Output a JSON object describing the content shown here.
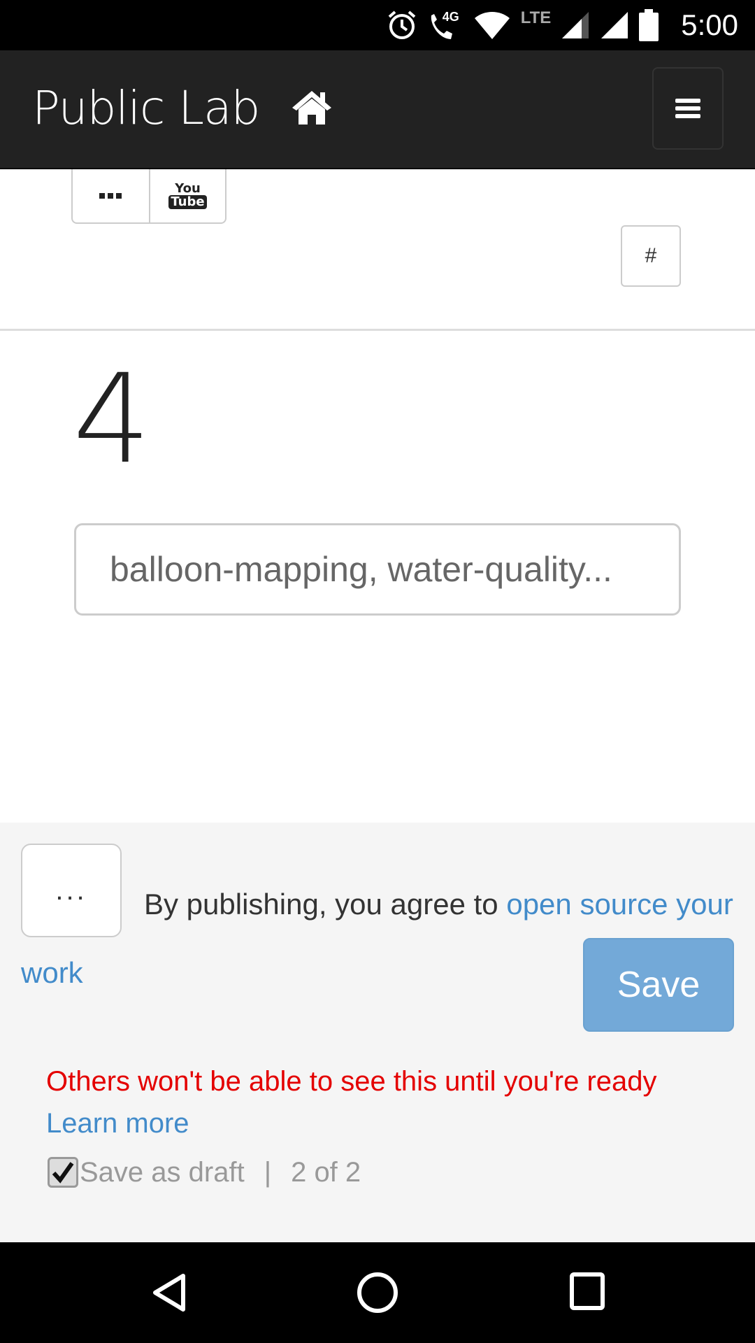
{
  "status_bar": {
    "network_label": "4G",
    "lte_label": "LTE",
    "time": "5:00",
    "icons": [
      "alarm-icon",
      "wifi-call-icon",
      "wifi-icon",
      "signal-icon",
      "signal-icon",
      "battery-icon"
    ]
  },
  "navbar": {
    "brand": "Public Lab",
    "home_icon": "home-icon",
    "menu_icon": "hamburger-menu-icon"
  },
  "toolbar": {
    "more_icon": "ellipsis-icon",
    "youtube_top": "You",
    "youtube_bottom": "Tube",
    "hash_label": "#"
  },
  "step": {
    "number": "4",
    "tags_placeholder": "balloon-mapping, water-quality..."
  },
  "footer": {
    "more_label": "...",
    "agree_prefix": "By publishing, you agree to ",
    "agree_link": "open source your work",
    "save_label": "Save",
    "draft_warning": "Others won't be able to see this until you're ready",
    "learn_more": "Learn more",
    "draft_label": "Save as draft",
    "separator": "|",
    "step_count": "2 of 2",
    "draft_checked": true,
    "save_color": "#73a9d8",
    "warning_color": "#e40000",
    "link_color": "#428bca"
  },
  "system_nav": {
    "back_icon": "back-icon",
    "home_icon": "home-circle-icon",
    "recents_icon": "recents-icon"
  }
}
